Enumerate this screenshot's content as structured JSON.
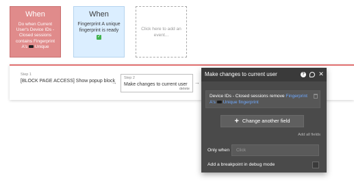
{
  "events": [
    {
      "title": "When",
      "description": "Do when Current User's Device IDs - Closed sessions contains Fingerprint A's",
      "description_suffix": "Unique"
    },
    {
      "title": "When",
      "description": "Fingerprint A unique fingerprint is ready",
      "status_icon": "check-icon"
    },
    {
      "title": "",
      "description": "Click here to add an event..."
    }
  ],
  "workflow": {
    "steps": [
      {
        "label": "Step 1",
        "text": "[BLOCK PAGE ACCESS] Show popup block"
      },
      {
        "label": "Step 2",
        "text": "Make changes to current user",
        "delete_label": "delete"
      }
    ],
    "arrow": "→"
  },
  "panel": {
    "title": "Make changes to current user",
    "help_icon": "?",
    "close_icon": "✕",
    "field": {
      "name": "Device IDs - Closed sessions remove",
      "value_part1": "Fingerprint",
      "value_prefix": "A's",
      "value_part2": "Unique fingerprint"
    },
    "change_field_label": "Change another field",
    "plus_icon": "+",
    "add_all_label": "Add all fields",
    "only_when_label": "Only when",
    "only_when_placeholder": "Click",
    "breakpoint_label": "Add a breakpoint in debug mode"
  },
  "colors": {
    "event_active": "#e08b8b",
    "event_trigger": "#dbeeff",
    "accent_red": "#e06f6f",
    "panel_bg": "#4a4a4a",
    "link_blue": "#6fa9ff"
  }
}
